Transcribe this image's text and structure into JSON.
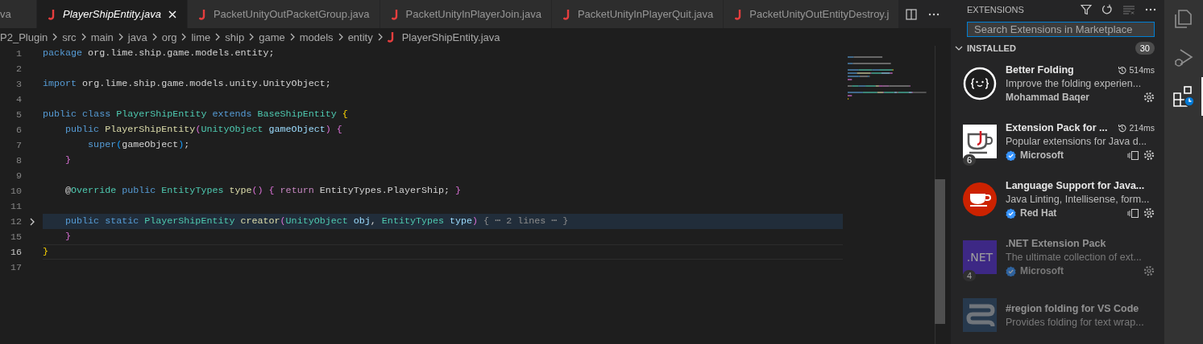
{
  "tabs": [
    {
      "label": "va",
      "selected": false,
      "preview": false,
      "icon": false
    },
    {
      "label": "PlayerShipEntity.java",
      "selected": true,
      "preview": true,
      "icon": true
    },
    {
      "label": "PacketUnityOutPacketGroup.java",
      "selected": false,
      "preview": false,
      "icon": true
    },
    {
      "label": "PacketUnityInPlayerJoin.java",
      "selected": false,
      "preview": false,
      "icon": true
    },
    {
      "label": "PacketUnityInPlayerQuit.java",
      "selected": false,
      "preview": false,
      "icon": true
    },
    {
      "label": "PacketUnityOutEntityDestroy.j",
      "selected": false,
      "preview": false,
      "icon": true
    }
  ],
  "breadcrumbs": [
    {
      "label": "P2_Plugin",
      "icon": false
    },
    {
      "label": "src",
      "icon": false
    },
    {
      "label": "main",
      "icon": false
    },
    {
      "label": "java",
      "icon": false
    },
    {
      "label": "org",
      "icon": false
    },
    {
      "label": "lime",
      "icon": false
    },
    {
      "label": "ship",
      "icon": false
    },
    {
      "label": "game",
      "icon": false
    },
    {
      "label": "models",
      "icon": false
    },
    {
      "label": "entity",
      "icon": false
    },
    {
      "label": "PlayerShipEntity.java",
      "icon": true
    }
  ],
  "lines": [
    {
      "number": "1",
      "current": false,
      "folded": false,
      "tokens": [
        {
          "kind": "kw",
          "text": "package"
        },
        {
          "kind": "plain",
          "text": " org.lime.ship.game.models.entity;"
        }
      ]
    },
    {
      "number": "2",
      "current": false,
      "folded": false
    },
    {
      "number": "3",
      "current": false,
      "folded": false,
      "tokens": [
        {
          "kind": "kw",
          "text": "import"
        },
        {
          "kind": "plain",
          "text": " org.lime.ship.game.models.unity.UnityObject;"
        }
      ]
    },
    {
      "number": "4",
      "current": false,
      "folded": false
    },
    {
      "number": "5",
      "current": false,
      "folded": false,
      "tokens": [
        {
          "kind": "kw",
          "text": "public class "
        },
        {
          "kind": "type",
          "text": "PlayerShipEntity"
        },
        {
          "kind": "kw",
          "text": " extends "
        },
        {
          "kind": "type",
          "text": "BaseShipEntity "
        },
        {
          "kind": "b1",
          "text": "{"
        }
      ]
    },
    {
      "number": "6",
      "current": false,
      "folded": false,
      "tokens": [
        {
          "kind": "kw",
          "text": "    public "
        },
        {
          "kind": "fn",
          "text": "PlayerShipEntity"
        },
        {
          "kind": "b2",
          "text": "("
        },
        {
          "kind": "type",
          "text": "UnityObject "
        },
        {
          "kind": "var",
          "text": "gameObject"
        },
        {
          "kind": "b2",
          "text": ") {"
        }
      ]
    },
    {
      "number": "7",
      "current": false,
      "folded": false,
      "tokens": [
        {
          "kind": "kw",
          "text": "        super"
        },
        {
          "kind": "b3",
          "text": "("
        },
        {
          "kind": "plain",
          "text": "gameObject"
        },
        {
          "kind": "b3",
          "text": ")"
        },
        {
          "kind": "plain",
          "text": ";"
        }
      ]
    },
    {
      "number": "8",
      "current": false,
      "folded": false,
      "tokens": [
        {
          "kind": "b2",
          "text": "    }"
        }
      ]
    },
    {
      "number": "9",
      "current": false,
      "folded": false
    },
    {
      "number": "10",
      "current": false,
      "folded": false,
      "tokens": [
        {
          "kind": "plain",
          "text": "    @"
        },
        {
          "kind": "type",
          "text": "Override"
        },
        {
          "kind": "kw",
          "text": " public "
        },
        {
          "kind": "type",
          "text": "EntityTypes "
        },
        {
          "kind": "fn",
          "text": "type"
        },
        {
          "kind": "b2",
          "text": "() {"
        },
        {
          "kind": "ctl",
          "text": " return "
        },
        {
          "kind": "plain",
          "text": "EntityTypes.PlayerShip; "
        },
        {
          "kind": "b2",
          "text": "}"
        }
      ]
    },
    {
      "number": "11",
      "current": false,
      "folded": false
    },
    {
      "number": "12",
      "current": false,
      "folded": true,
      "tokens": [
        {
          "kind": "kw",
          "text": "    public static "
        },
        {
          "kind": "type",
          "text": "PlayerShipEntity "
        },
        {
          "kind": "fn",
          "text": "creator"
        },
        {
          "kind": "b2",
          "text": "("
        },
        {
          "kind": "type",
          "text": "UnityObject "
        },
        {
          "kind": "var",
          "text": "obj"
        },
        {
          "kind": "plain",
          "text": ", "
        },
        {
          "kind": "type",
          "text": "EntityTypes "
        },
        {
          "kind": "var",
          "text": "type"
        },
        {
          "kind": "b2",
          "text": ")"
        },
        {
          "kind": "fold",
          "text": " { ⋯ 2 lines ⋯ }"
        }
      ]
    },
    {
      "number": "15",
      "current": false,
      "folded": false,
      "tokens": [
        {
          "kind": "b2",
          "text": "    }"
        }
      ]
    },
    {
      "number": "16",
      "current": true,
      "folded": false,
      "tokens": [
        {
          "kind": "b1",
          "text": "}"
        }
      ]
    },
    {
      "number": "17",
      "current": false,
      "folded": false
    }
  ],
  "extensions": {
    "title": "EXTENSIONS",
    "search": {
      "placeholder": "Search Extensions in Marketplace"
    },
    "section": {
      "label": "INSTALLED",
      "count": "30",
      "expanded": true
    },
    "items": [
      {
        "kind": "folding",
        "name": "Better Folding",
        "time": "514ms",
        "description": "Improve the folding experien...",
        "publisher": "Mohammad Baqer",
        "verified": false,
        "disabled": false,
        "split": false
      },
      {
        "kind": "cup",
        "name": "Extension Pack for ...",
        "time": "214ms",
        "badge": "6",
        "description": "Popular extensions for Java d...",
        "publisher": "Microsoft",
        "verified": true,
        "disabled": false,
        "split": true
      },
      {
        "kind": "redcup",
        "name": "Language Support for Java...",
        "description": "Java Linting, Intellisense, form...",
        "publisher": "Red Hat",
        "verified": true,
        "disabled": false,
        "split": true
      },
      {
        "kind": "dotnet",
        "logo_text": ".NET",
        "name": ".NET Extension Pack",
        "badge": "4",
        "description": "The ultimate collection of ext...",
        "publisher": "Microsoft",
        "verified": true,
        "disabled": true,
        "split": false
      },
      {
        "kind": "region",
        "name": "#region folding for VS Code",
        "description": "Provides folding for text wrap...",
        "disabled": true,
        "verified": false,
        "split": false
      }
    ]
  },
  "activity": [
    {
      "kind": "files",
      "selected": false
    },
    {
      "kind": "debug",
      "selected": false
    },
    {
      "kind": "extensions",
      "selected": true
    }
  ]
}
